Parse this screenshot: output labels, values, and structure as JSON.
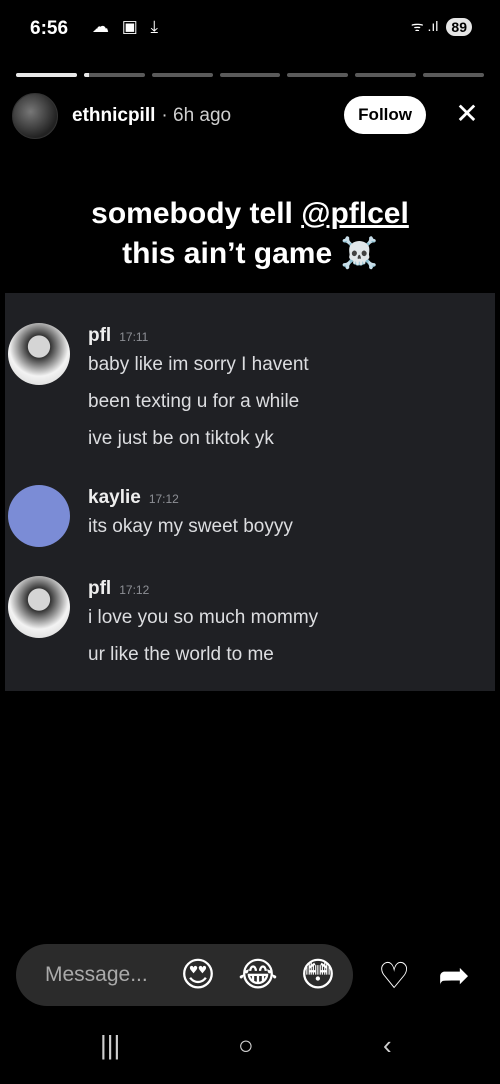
{
  "status_bar": {
    "time": "6:56",
    "left_icons": "☁ ▣ ⤓",
    "signal": "ᯤ .ıl",
    "battery": "89"
  },
  "progress": {
    "segments": 7,
    "active_index": 1,
    "active_fraction": 0.08
  },
  "header": {
    "username": "ethnicpill",
    "time_ago": "· 6h ago",
    "follow_label": "Follow",
    "close_icon": "✕"
  },
  "caption": {
    "line1_prefix": "somebody tell ",
    "mention": "@pflcel",
    "line2": "this ain’t game ☠️"
  },
  "chat": {
    "messages": [
      {
        "author": "pfl",
        "time": "17:11",
        "avatar": "photo",
        "lines": [
          "baby like im sorry I havent",
          "been texting u for a while",
          "ive just be on tiktok yk"
        ]
      },
      {
        "author": "kaylie",
        "time": "17:12",
        "avatar": "blue",
        "lines": [
          "its okay my sweet boyyy"
        ]
      },
      {
        "author": "pfl",
        "time": "17:12",
        "avatar": "photo",
        "lines": [
          "i love you so much mommy",
          "ur like the world to me"
        ]
      }
    ]
  },
  "reply_bar": {
    "placeholder": "Message...",
    "reactions": [
      "😍",
      "😂",
      "😳"
    ],
    "heart_icon": "♡",
    "share_icon": "➦"
  },
  "nav_bar": {
    "recents": "|||",
    "home": "○",
    "back": "‹"
  }
}
